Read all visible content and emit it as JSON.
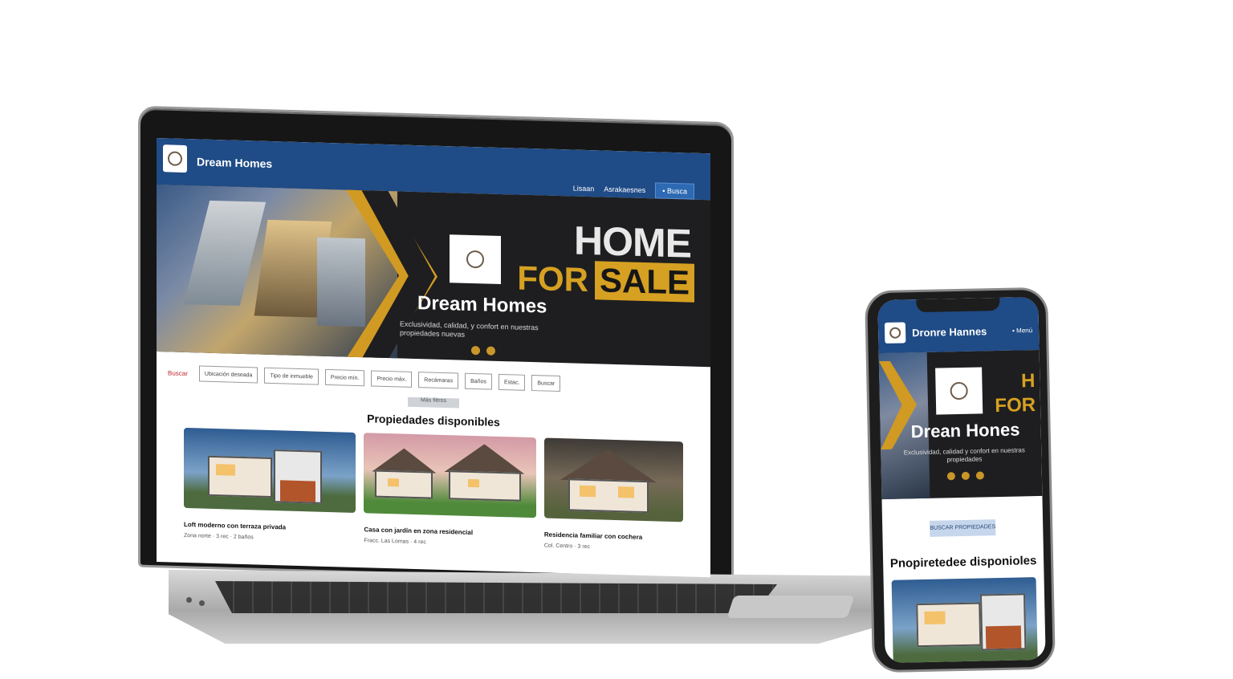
{
  "laptop": {
    "nav": {
      "brand": "Dream Homes",
      "link1": "Lisaan",
      "link2": "Asrakaesnes",
      "cta": "Busca"
    },
    "hero": {
      "headline1": "HOME",
      "headline2_a": "FOR",
      "headline2_b": "SALE",
      "brand": "Dream Homes",
      "tagline": "Exclusividad, calidad, y confort en nuestras propiedades nuevas"
    },
    "filters": {
      "label": "Buscar",
      "options": [
        "Ubicación deseada",
        "Tipo de inmueble",
        "Precio mín.",
        "Precio máx.",
        "Recámaras",
        "Baños",
        "Estac.",
        "Buscar"
      ],
      "submit": "Más filtros"
    },
    "section_title": "Propiedades disponibles",
    "cards": [
      {
        "title": "Loft moderno con terraza privada",
        "subtitle": "Zona norte · 3 rec · 2 baños"
      },
      {
        "title": "Casa con jardín en zona residencial",
        "subtitle": "Fracc. Las Lomas · 4 rec"
      },
      {
        "title": "Residencia familiar con cochera",
        "subtitle": "Col. Centro · 3 rec"
      }
    ]
  },
  "phone": {
    "nav": {
      "brand": "Dronre Hannes",
      "menu": "Menú"
    },
    "hero": {
      "h_line1": "H",
      "h_line2": "FOR",
      "brand": "Drean Hones",
      "tagline": "Exclusividad, calidad y confort en nuestras propiedades"
    },
    "button": "BUSCAR PROPIEDADES",
    "section_title": "Pnopiretedee disponioles"
  },
  "colors": {
    "nav_blue": "#1f4b86",
    "gold": "#d6a022",
    "hero_dark": "#1e1e20"
  }
}
